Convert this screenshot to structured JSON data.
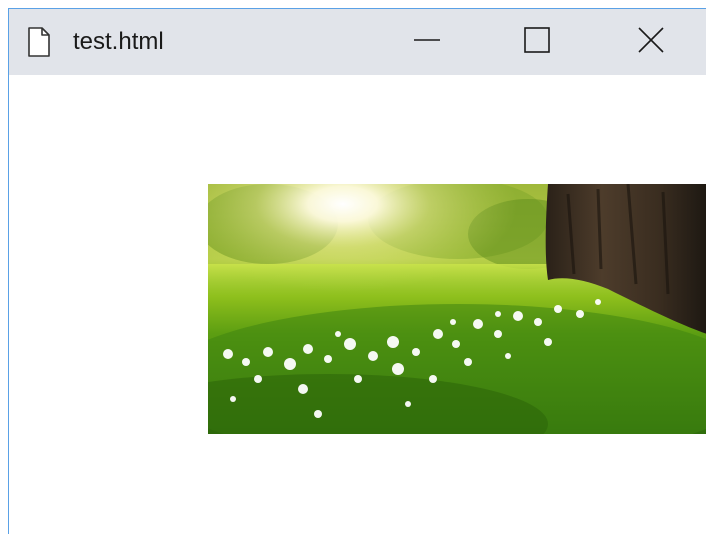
{
  "window": {
    "title": "test.html",
    "icons": {
      "document": "document-icon",
      "minimize": "minimize-icon",
      "maximize": "maximize-icon",
      "close": "close-icon"
    }
  },
  "content": {
    "image": {
      "subject": "forest-meadow-photo",
      "colors": {
        "sunlight": "#fffbe0",
        "grass": "#4f9a12",
        "foliage": "#8dae2a",
        "trunk": "#3e2f22",
        "flowers": "#ffffff"
      }
    }
  },
  "theme": {
    "titlebar_bg": "#e1e4ea",
    "window_border": "#5aa1e6",
    "page_bg": "#ffffff"
  }
}
